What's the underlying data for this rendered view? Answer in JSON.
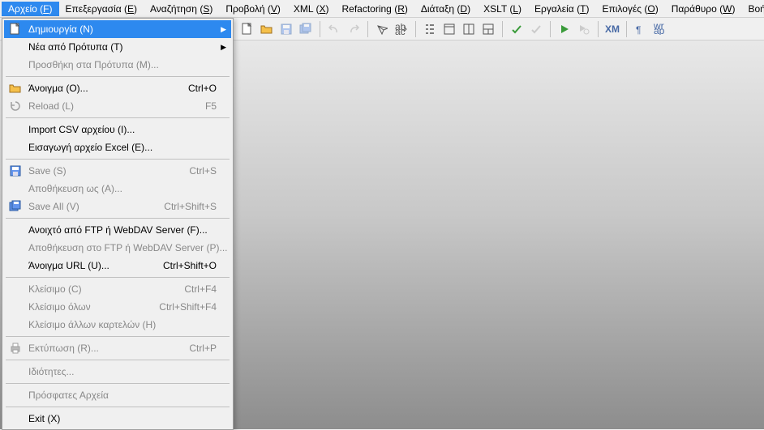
{
  "menubar": [
    {
      "label": "Αρχείο",
      "mn": "F",
      "active": true
    },
    {
      "label": "Επεξεργασία",
      "mn": "E"
    },
    {
      "label": "Αναζήτηση",
      "mn": "S"
    },
    {
      "label": "Προβολή",
      "mn": "V"
    },
    {
      "label": "XML",
      "mn": "X"
    },
    {
      "label": "Refactoring",
      "mn": "R"
    },
    {
      "label": "Διάταξη",
      "mn": "D"
    },
    {
      "label": "XSLT",
      "mn": "L"
    },
    {
      "label": "Εργαλεία",
      "mn": "T"
    },
    {
      "label": "Επιλογές",
      "mn": "O"
    },
    {
      "label": "Παράθυρο",
      "mn": "W"
    },
    {
      "label": "Βοήθεια",
      "mn": "H"
    }
  ],
  "toolbar_icons": [
    "new-file-icon",
    "open-file-icon",
    "save-icon",
    "save-all-icon",
    "sep",
    "undo-icon",
    "redo-icon",
    "sep",
    "find-icon",
    "find-replace-icon",
    "sep",
    "outline-icon",
    "window-icon",
    "layout1-icon",
    "layout2-icon",
    "sep",
    "validate-icon",
    "check-icon",
    "sep",
    "run-icon",
    "run-config-icon",
    "sep",
    "xml-icon",
    "sep",
    "pilcrow-icon",
    "wrap-icon"
  ],
  "dropdown": [
    {
      "type": "item",
      "label": "Δημιουργία (N)",
      "icon": "new-file-icon",
      "submenu": true,
      "highlighted": true
    },
    {
      "type": "item",
      "label": "Νέα από Πρότυπα (T)",
      "submenu": true
    },
    {
      "type": "item",
      "label": "Προσθήκη στα Πρότυπα (M)...",
      "disabled": true
    },
    {
      "type": "sep"
    },
    {
      "type": "item",
      "label": "Άνοιγμα (O)...",
      "icon": "open-file-icon",
      "accel": "Ctrl+O"
    },
    {
      "type": "item",
      "label": "Reload (L)",
      "icon": "reload-icon",
      "accel": "F5",
      "disabled": true
    },
    {
      "type": "sep"
    },
    {
      "type": "item",
      "label": "Import CSV αρχείου (I)..."
    },
    {
      "type": "item",
      "label": "Εισαγωγή αρχείο Excel (E)..."
    },
    {
      "type": "sep"
    },
    {
      "type": "item",
      "label": "Save (S)",
      "icon": "save-icon",
      "accel": "Ctrl+S",
      "disabled": true
    },
    {
      "type": "item",
      "label": "Αποθήκευση ως (A)...",
      "disabled": true
    },
    {
      "type": "item",
      "label": "Save All (V)",
      "icon": "save-all-icon",
      "accel": "Ctrl+Shift+S",
      "disabled": true
    },
    {
      "type": "sep"
    },
    {
      "type": "item",
      "label": "Ανοιχτό από FTP ή WebDAV Server (F)..."
    },
    {
      "type": "item",
      "label": "Αποθήκευση στο FTP ή WebDAV Server (P)...",
      "disabled": true
    },
    {
      "type": "item",
      "label": "Άνοιγμα URL (U)...",
      "accel": "Ctrl+Shift+O"
    },
    {
      "type": "sep"
    },
    {
      "type": "item",
      "label": "Κλείσιμο (C)",
      "accel": "Ctrl+F4",
      "disabled": true
    },
    {
      "type": "item",
      "label": "Κλείσιμο όλων",
      "accel": "Ctrl+Shift+F4",
      "disabled": true
    },
    {
      "type": "item",
      "label": "Κλείσιμο άλλων καρτελών (H)",
      "disabled": true
    },
    {
      "type": "sep"
    },
    {
      "type": "item",
      "label": "Εκτύπωση (R)...",
      "icon": "print-icon",
      "accel": "Ctrl+P",
      "disabled": true
    },
    {
      "type": "sep"
    },
    {
      "type": "item",
      "label": "Ιδιότητες...",
      "disabled": true
    },
    {
      "type": "sep"
    },
    {
      "type": "item",
      "label": "Πρόσφατες Αρχεία",
      "disabled": true
    },
    {
      "type": "sep"
    },
    {
      "type": "item",
      "label": "Exit (X)"
    }
  ]
}
